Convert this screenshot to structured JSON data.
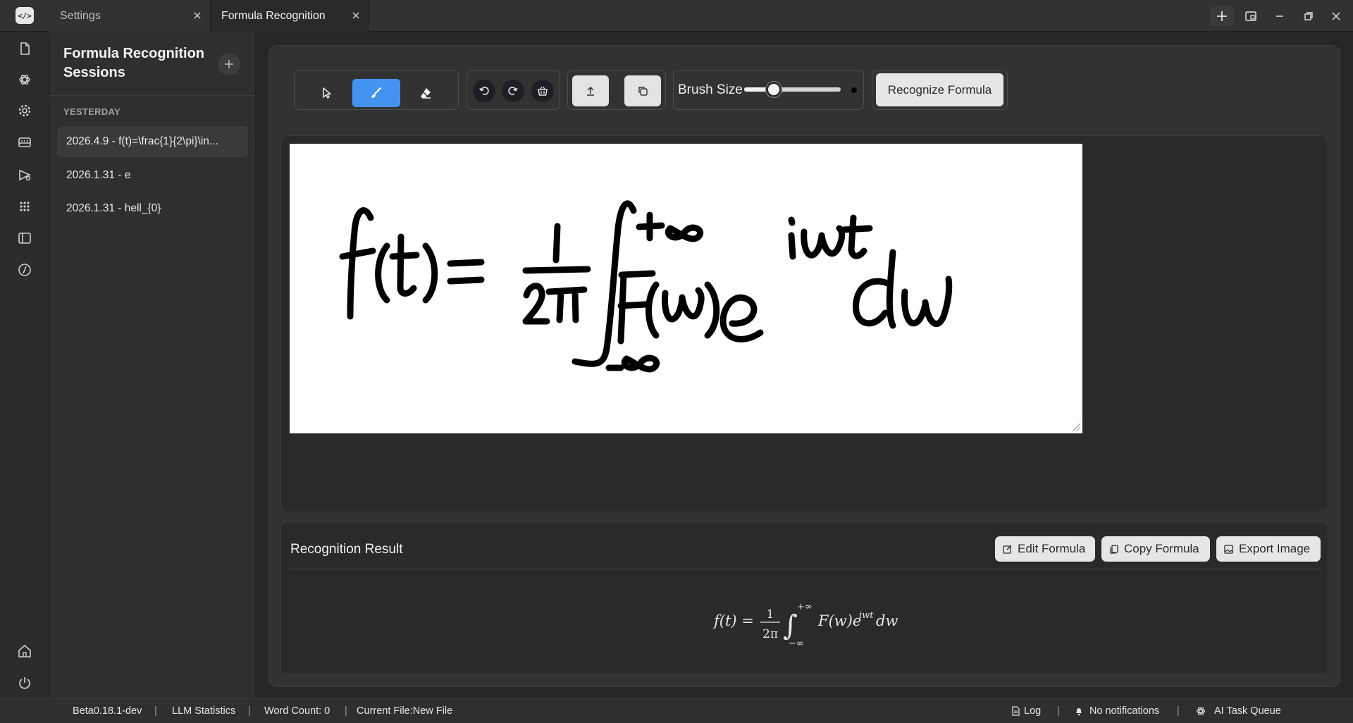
{
  "app": {
    "logo_text": "</>"
  },
  "tabs": [
    {
      "label": "Settings",
      "active": false
    },
    {
      "label": "Formula Recognition",
      "active": true
    }
  ],
  "sidebar": {
    "title": "Formula Recognition Sessions",
    "group_label": "YESTERDAY",
    "sessions": [
      {
        "label": "2026.4.9 - f(t)=\\frac{1}{2\\pi}\\in...",
        "active": true
      },
      {
        "label": "2026.1.31 - e",
        "active": false
      },
      {
        "label": "2026.1.31 - hell_{0}",
        "active": false
      }
    ]
  },
  "activity_bar": [
    "file-icon",
    "ai-icon",
    "settings-icon",
    "keyboard-icon",
    "tool-icon",
    "apps-grid-icon",
    "panel-icon",
    "code-icon",
    "home-icon",
    "power-icon"
  ],
  "toolbar": {
    "tools": [
      "select-cursor-icon",
      "brush-icon",
      "eraser-icon"
    ],
    "active_tool": "brush",
    "brush_size_label": "Brush Size",
    "brush_size_fraction": 0.27,
    "recognize_label": "Recognize Formula"
  },
  "canvas": {
    "handwritten_formula": "f(t) = 1/2π ∫_{-∞}^{+∞} F(w) e^{iwt} dw"
  },
  "result": {
    "title": "Recognition Result",
    "edit_label": "Edit Formula",
    "copy_label": "Copy Formula",
    "export_label": "Export Image",
    "formula": {
      "lhs": "f(t) =",
      "numerator": "1",
      "denominator": "2π",
      "integral": "∫",
      "upper": "+∞",
      "lower": "−∞",
      "body": "F(w)e",
      "exponent": "iwt",
      "tail": "dw"
    }
  },
  "status_bar": {
    "version": "Beta0.18.1-dev",
    "llm_stats": "LLM Statistics",
    "word_count": "Word Count: 0",
    "current_file": "Current File:New File",
    "log": "Log",
    "notifications": "No notifications",
    "task_queue": "AI Task Queue"
  },
  "colors": {
    "accent": "#4394f0",
    "background": "#272727"
  }
}
